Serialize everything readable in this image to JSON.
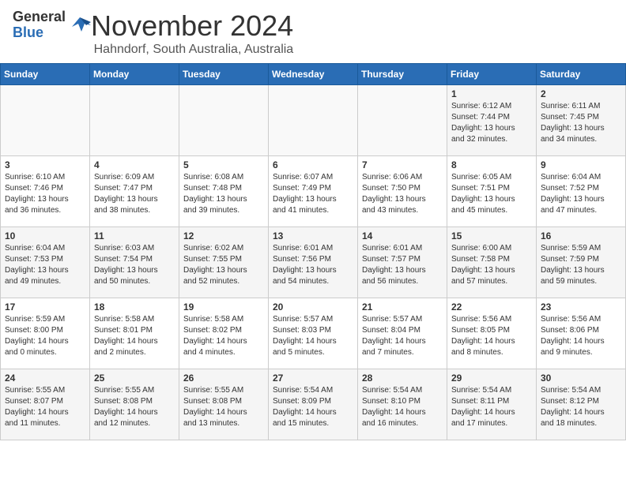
{
  "header": {
    "logo_general": "General",
    "logo_blue": "Blue",
    "month": "November 2024",
    "location": "Hahndorf, South Australia, Australia"
  },
  "days_of_week": [
    "Sunday",
    "Monday",
    "Tuesday",
    "Wednesday",
    "Thursday",
    "Friday",
    "Saturday"
  ],
  "weeks": [
    [
      {
        "day": "",
        "info": ""
      },
      {
        "day": "",
        "info": ""
      },
      {
        "day": "",
        "info": ""
      },
      {
        "day": "",
        "info": ""
      },
      {
        "day": "",
        "info": ""
      },
      {
        "day": "1",
        "info": "Sunrise: 6:12 AM\nSunset: 7:44 PM\nDaylight: 13 hours\nand 32 minutes."
      },
      {
        "day": "2",
        "info": "Sunrise: 6:11 AM\nSunset: 7:45 PM\nDaylight: 13 hours\nand 34 minutes."
      }
    ],
    [
      {
        "day": "3",
        "info": "Sunrise: 6:10 AM\nSunset: 7:46 PM\nDaylight: 13 hours\nand 36 minutes."
      },
      {
        "day": "4",
        "info": "Sunrise: 6:09 AM\nSunset: 7:47 PM\nDaylight: 13 hours\nand 38 minutes."
      },
      {
        "day": "5",
        "info": "Sunrise: 6:08 AM\nSunset: 7:48 PM\nDaylight: 13 hours\nand 39 minutes."
      },
      {
        "day": "6",
        "info": "Sunrise: 6:07 AM\nSunset: 7:49 PM\nDaylight: 13 hours\nand 41 minutes."
      },
      {
        "day": "7",
        "info": "Sunrise: 6:06 AM\nSunset: 7:50 PM\nDaylight: 13 hours\nand 43 minutes."
      },
      {
        "day": "8",
        "info": "Sunrise: 6:05 AM\nSunset: 7:51 PM\nDaylight: 13 hours\nand 45 minutes."
      },
      {
        "day": "9",
        "info": "Sunrise: 6:04 AM\nSunset: 7:52 PM\nDaylight: 13 hours\nand 47 minutes."
      }
    ],
    [
      {
        "day": "10",
        "info": "Sunrise: 6:04 AM\nSunset: 7:53 PM\nDaylight: 13 hours\nand 49 minutes."
      },
      {
        "day": "11",
        "info": "Sunrise: 6:03 AM\nSunset: 7:54 PM\nDaylight: 13 hours\nand 50 minutes."
      },
      {
        "day": "12",
        "info": "Sunrise: 6:02 AM\nSunset: 7:55 PM\nDaylight: 13 hours\nand 52 minutes."
      },
      {
        "day": "13",
        "info": "Sunrise: 6:01 AM\nSunset: 7:56 PM\nDaylight: 13 hours\nand 54 minutes."
      },
      {
        "day": "14",
        "info": "Sunrise: 6:01 AM\nSunset: 7:57 PM\nDaylight: 13 hours\nand 56 minutes."
      },
      {
        "day": "15",
        "info": "Sunrise: 6:00 AM\nSunset: 7:58 PM\nDaylight: 13 hours\nand 57 minutes."
      },
      {
        "day": "16",
        "info": "Sunrise: 5:59 AM\nSunset: 7:59 PM\nDaylight: 13 hours\nand 59 minutes."
      }
    ],
    [
      {
        "day": "17",
        "info": "Sunrise: 5:59 AM\nSunset: 8:00 PM\nDaylight: 14 hours\nand 0 minutes."
      },
      {
        "day": "18",
        "info": "Sunrise: 5:58 AM\nSunset: 8:01 PM\nDaylight: 14 hours\nand 2 minutes."
      },
      {
        "day": "19",
        "info": "Sunrise: 5:58 AM\nSunset: 8:02 PM\nDaylight: 14 hours\nand 4 minutes."
      },
      {
        "day": "20",
        "info": "Sunrise: 5:57 AM\nSunset: 8:03 PM\nDaylight: 14 hours\nand 5 minutes."
      },
      {
        "day": "21",
        "info": "Sunrise: 5:57 AM\nSunset: 8:04 PM\nDaylight: 14 hours\nand 7 minutes."
      },
      {
        "day": "22",
        "info": "Sunrise: 5:56 AM\nSunset: 8:05 PM\nDaylight: 14 hours\nand 8 minutes."
      },
      {
        "day": "23",
        "info": "Sunrise: 5:56 AM\nSunset: 8:06 PM\nDaylight: 14 hours\nand 9 minutes."
      }
    ],
    [
      {
        "day": "24",
        "info": "Sunrise: 5:55 AM\nSunset: 8:07 PM\nDaylight: 14 hours\nand 11 minutes."
      },
      {
        "day": "25",
        "info": "Sunrise: 5:55 AM\nSunset: 8:08 PM\nDaylight: 14 hours\nand 12 minutes."
      },
      {
        "day": "26",
        "info": "Sunrise: 5:55 AM\nSunset: 8:08 PM\nDaylight: 14 hours\nand 13 minutes."
      },
      {
        "day": "27",
        "info": "Sunrise: 5:54 AM\nSunset: 8:09 PM\nDaylight: 14 hours\nand 15 minutes."
      },
      {
        "day": "28",
        "info": "Sunrise: 5:54 AM\nSunset: 8:10 PM\nDaylight: 14 hours\nand 16 minutes."
      },
      {
        "day": "29",
        "info": "Sunrise: 5:54 AM\nSunset: 8:11 PM\nDaylight: 14 hours\nand 17 minutes."
      },
      {
        "day": "30",
        "info": "Sunrise: 5:54 AM\nSunset: 8:12 PM\nDaylight: 14 hours\nand 18 minutes."
      }
    ]
  ]
}
